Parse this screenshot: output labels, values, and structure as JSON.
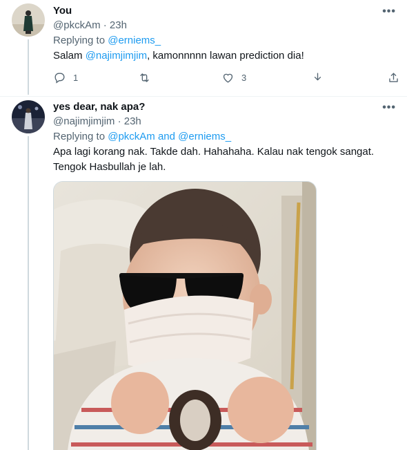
{
  "tweet1": {
    "display_name": "You",
    "handle": "@pkckAm",
    "sep": "·",
    "time": "23h",
    "replying_prefix": "Replying to",
    "replying_to": "@erniems_",
    "text_before": "Salam ",
    "mention": "@najimjimjim",
    "text_after": ", kamonnnnn lawan prediction dia!",
    "reply_count": "1",
    "retweet_count": "",
    "like_count": "3",
    "more_label": "•••"
  },
  "tweet2": {
    "display_name": "yes dear, nak apa?",
    "handle": "@najimjimjim",
    "sep": "·",
    "time": "23h",
    "replying_prefix": "Replying to",
    "replying_to_1": "@pkckAm",
    "and_word": "and",
    "replying_to_2": "@erniems_",
    "text_line1": "Apa lagi korang nak. Takde dah. Hahahaha. Kalau nak tengok sangat.",
    "text_line2": "Tengok Hasbullah je lah.",
    "more_label": "•••"
  },
  "colors": {
    "accent": "#1d9bf0",
    "muted": "#536471",
    "text": "#0f1419",
    "border": "#cfd9de"
  },
  "icons": [
    "reply-icon",
    "retweet-icon",
    "like-icon",
    "download-icon",
    "share-icon",
    "more-icon"
  ]
}
